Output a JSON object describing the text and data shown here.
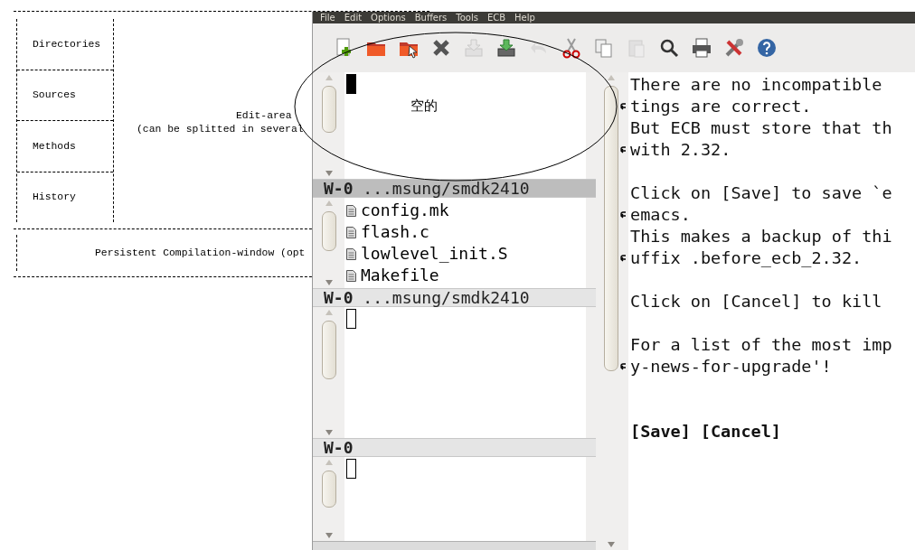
{
  "diagram": {
    "panes": [
      "Directories",
      "Sources",
      "Methods",
      "History"
    ],
    "edit_area": [
      "Edit-area",
      "(can be splitted in several"
    ],
    "compilation": "Persistent Compilation-window (opt"
  },
  "menu": [
    "File",
    "Edit",
    "Options",
    "Buffers",
    "Tools",
    "ECB",
    "Help"
  ],
  "toolbar": [
    {
      "kind": "new",
      "disabled": false
    },
    {
      "kind": "open",
      "disabled": false
    },
    {
      "kind": "dired",
      "disabled": false
    },
    {
      "kind": "close",
      "disabled": false
    },
    {
      "kind": "save",
      "disabled": true
    },
    {
      "kind": "saveas",
      "disabled": false
    },
    {
      "kind": "undo",
      "disabled": true
    },
    {
      "kind": "cut",
      "disabled": false
    },
    {
      "kind": "copy",
      "disabled": false
    },
    {
      "kind": "paste",
      "disabled": true
    },
    {
      "kind": "search",
      "disabled": false
    },
    {
      "kind": "print",
      "disabled": false
    },
    {
      "kind": "prefs",
      "disabled": false
    },
    {
      "kind": "help",
      "disabled": false
    }
  ],
  "annotation": {
    "note": "空的"
  },
  "ecb_windows": [
    {
      "cursor": {
        "focused": true
      },
      "modeline": {
        "window_id": "W-0",
        "path": "...msung/smdk2410",
        "selected": true
      }
    },
    {
      "items": [
        "config.mk",
        "flash.c",
        "lowlevel_init.S",
        "Makefile"
      ],
      "modeline": {
        "window_id": "W-0",
        "path": "...msung/smdk2410",
        "selected": false
      }
    },
    {
      "cursor": {
        "focused": false
      },
      "modeline": {
        "window_id": "W-0",
        "selected": false
      }
    },
    {
      "cursor": {
        "focused": false
      }
    }
  ],
  "editor": {
    "lines": [
      {
        "text": "There are no incompatible",
        "continued": false
      },
      {
        "text": "tings are correct.",
        "continued": true
      },
      {
        "text": "But ECB must store that th",
        "continued": false
      },
      {
        "text": "with 2.32.",
        "continued": true
      },
      {
        "continued": false
      },
      {
        "text": "Click on [Save] to save `e",
        "continued": false
      },
      {
        "text": "emacs.",
        "continued": true
      },
      {
        "text": "This makes a backup of thi",
        "continued": false
      },
      {
        "text": "uffix .before_ecb_2.32.",
        "continued": true
      },
      {
        "continued": false
      },
      {
        "text": "Click on [Cancel] to kill",
        "continued": false
      },
      {
        "continued": false
      },
      {
        "text": "For a list of the most imp",
        "continued": false
      },
      {
        "text": "y-news-for-upgrade'!",
        "continued": true
      },
      {
        "continued": false
      },
      {
        "continued": false
      }
    ],
    "buttons": [
      "[Save]",
      "[Cancel]"
    ]
  }
}
